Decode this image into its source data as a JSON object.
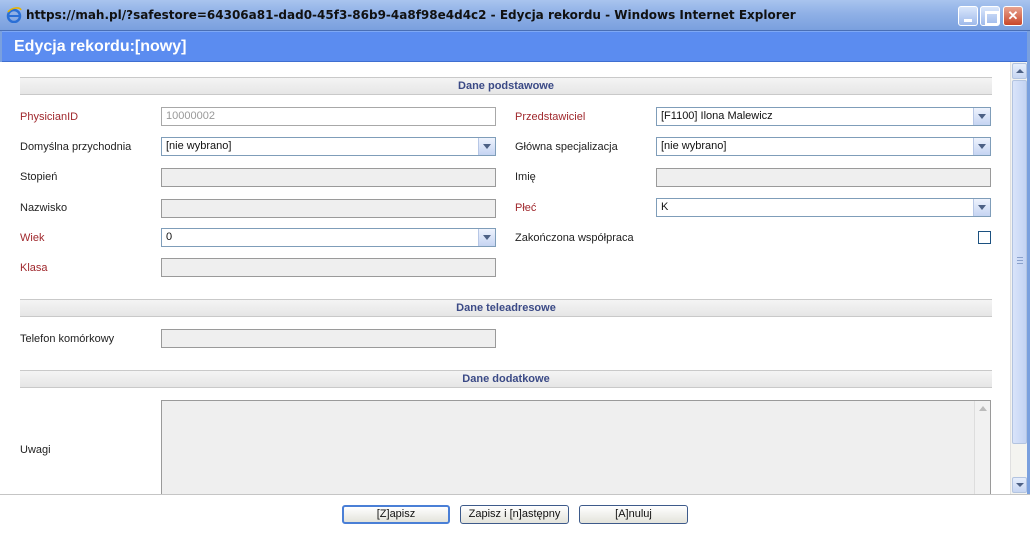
{
  "window": {
    "title": "https://mah.pl/?safestore=64306a81-dad0-45f3-86b9-4a8f98e4d4c2 - Edycja rekordu - Windows Internet Explorer",
    "icon": "ie-icon"
  },
  "dialog": {
    "title": "Edycja rekordu:[nowy]"
  },
  "sections": {
    "basic": "Dane podstawowe",
    "contact": "Dane teleadresowe",
    "additional": "Dane dodatkowe"
  },
  "fields": {
    "physician_id": {
      "label": "PhysicianID",
      "value": "10000002",
      "required": true
    },
    "rep": {
      "label": "Przedstawiciel",
      "value": "[F1100] Ilona Malewicz",
      "required": true
    },
    "default_clinic": {
      "label": "Domyślna przychodnia",
      "value": "[nie wybrano]"
    },
    "main_specialization": {
      "label": "Główna specjalizacja",
      "value": "[nie wybrano]"
    },
    "degree": {
      "label": "Stopień",
      "value": ""
    },
    "first_name": {
      "label": "Imię",
      "value": ""
    },
    "last_name": {
      "label": "Nazwisko",
      "value": ""
    },
    "gender": {
      "label": "Płeć",
      "value": "K",
      "required": true
    },
    "age": {
      "label": "Wiek",
      "value": "0",
      "required": true
    },
    "cooperation_ended": {
      "label": "Zakończona współpraca",
      "checked": false
    },
    "class": {
      "label": "Klasa",
      "value": "",
      "required": true
    },
    "mobile_phone": {
      "label": "Telefon komórkowy",
      "value": ""
    },
    "notes": {
      "label": "Uwagi",
      "value": ""
    }
  },
  "buttons": {
    "save": "[Z]apisz",
    "save_next": "Zapisz i [n]astępny",
    "cancel": "[A]nuluj"
  },
  "colors": {
    "dialog_header": "#5b8cf0",
    "required_label": "#a0282d",
    "section_text": "#3b4a86"
  }
}
